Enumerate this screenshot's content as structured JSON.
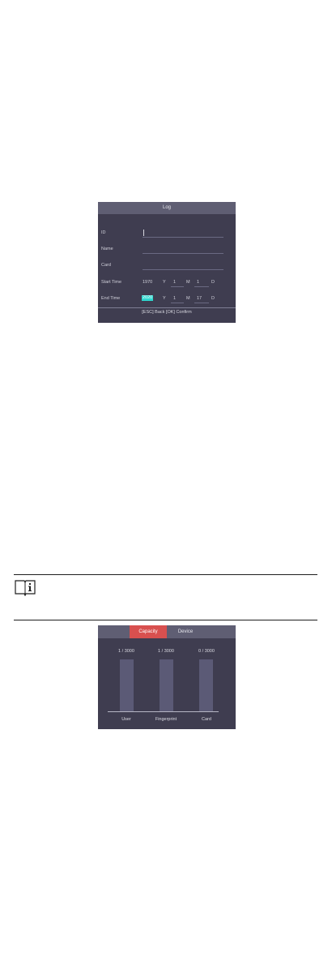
{
  "log_screen": {
    "title": "Log",
    "fields": {
      "id_label": "ID",
      "name_label": "Name",
      "card_label": "Card"
    },
    "start_time": {
      "label": "Start Time",
      "year": "1970",
      "year_unit": "Y",
      "month": "1",
      "month_unit": "M",
      "day": "1",
      "day_unit": "D"
    },
    "end_time": {
      "label": "End Time",
      "year": "2020",
      "year_unit": "Y",
      "month": "1",
      "month_unit": "M",
      "day": "17",
      "day_unit": "D"
    },
    "footer": "[ESC] Back [OK] Confirm"
  },
  "note": {
    "icon": "info-book-icon"
  },
  "capacity_screen": {
    "tabs": [
      {
        "label": "Capacity",
        "active": true
      },
      {
        "label": "Device",
        "active": false
      }
    ],
    "items": [
      {
        "label": "User",
        "count": "1 / 3000"
      },
      {
        "label": "Fingerprint",
        "count": "1 / 3000"
      },
      {
        "label": "Card",
        "count": "0 / 3000"
      }
    ],
    "colors": {
      "active_tab": "#d8504f",
      "bar": "#5b5a76"
    }
  }
}
